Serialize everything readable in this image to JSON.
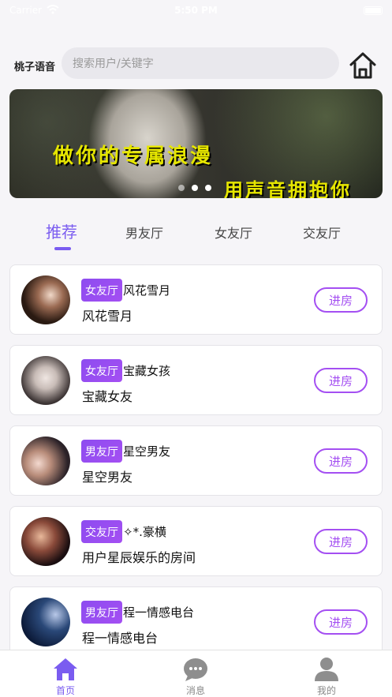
{
  "status_bar": {
    "carrier": "Carrier",
    "time": "5:50 PM"
  },
  "header": {
    "app_name": "桃子语音",
    "search_placeholder": "搜索用户/关键字"
  },
  "banner": {
    "line1": "做你的专属浪漫",
    "line2": "用声音拥抱你",
    "slide_count": 3,
    "active_slide": 2
  },
  "tabs": [
    {
      "label": "推荐",
      "active": true
    },
    {
      "label": "男友厅",
      "active": false
    },
    {
      "label": "女友厅",
      "active": false
    },
    {
      "label": "交友厅",
      "active": false
    }
  ],
  "rooms": [
    {
      "tag": "女友厅",
      "title": "风花雪月",
      "subtitle": "风花雪月",
      "enter_label": "进房"
    },
    {
      "tag": "女友厅",
      "title": "宝藏女孩",
      "subtitle": "宝藏女友",
      "enter_label": "进房"
    },
    {
      "tag": "男友厅",
      "title": "星空男友",
      "subtitle": "星空男友",
      "enter_label": "进房"
    },
    {
      "tag": "交友厅",
      "title": "✧*.豪横",
      "subtitle": "用户星辰娱乐的房间",
      "enter_label": "进房"
    },
    {
      "tag": "男友厅",
      "title": "程一情感电台",
      "subtitle": "程一情感电台",
      "enter_label": "进房"
    }
  ],
  "tabbar": [
    {
      "label": "首页",
      "icon": "home-icon",
      "active": true
    },
    {
      "label": "消息",
      "icon": "message-icon",
      "active": false
    },
    {
      "label": "我的",
      "icon": "profile-icon",
      "active": false
    }
  ],
  "colors": {
    "accent": "#7a5cf0",
    "badge": "#a44ff2",
    "banner_text": "#e6e600"
  }
}
